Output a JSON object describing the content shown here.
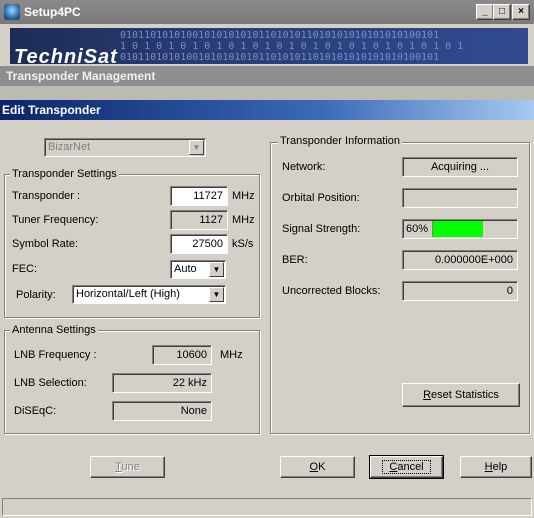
{
  "window": {
    "title": "Setup4PC"
  },
  "banner": {
    "logo": "TechniSat",
    "binary_rows": [
      "01011010101001010101010110101011010101010101010100101",
      "1 0 1 0 1 0 1 0 1 0 1 0 1 0 1 0 1 0 1 0 1 0 1 0 1 0 1 0 1"
    ]
  },
  "section": {
    "title": "Transponder Management"
  },
  "dialog": {
    "title": "Edit Transponder",
    "network_combo": "BizarNet",
    "transponder_settings": {
      "title": "Transponder Settings",
      "transponder_label": "Transponder :",
      "transponder_value": "11727",
      "transponder_unit": "MHz",
      "tuner_label": "Tuner Frequency:",
      "tuner_value": "1127",
      "tuner_unit": "MHz",
      "symbol_label": "Symbol Rate:",
      "symbol_value": "27500",
      "symbol_unit": "kS/s",
      "fec_label": "FEC:",
      "fec_value": "Auto",
      "polarity_label": "Polarity:",
      "polarity_value": "Horizontal/Left (High)"
    },
    "antenna_settings": {
      "title": "Antenna Settings",
      "lnb_freq_label": "LNB Frequency :",
      "lnb_freq_value": "10600",
      "lnb_freq_unit": "MHz",
      "lnb_sel_label": "LNB Selection:",
      "lnb_sel_value": "22 kHz",
      "diseqc_label": "DiSEqC:",
      "diseqc_value": "None"
    },
    "info": {
      "title": "Transponder Information",
      "network_label": "Network:",
      "network_value": "Acquiring ...",
      "orbital_label": "Orbital Position:",
      "orbital_value": "",
      "signal_label": "Signal Strength:",
      "signal_text": "60%",
      "signal_fraction": 0.6,
      "signal_color": "#00ff00",
      "ber_label": "BER:",
      "ber_value": "0.000000E+000",
      "uncorrected_label": "Uncorrected Blocks:",
      "uncorrected_value": "0",
      "reset_first": "R",
      "reset_rest": "eset Statistics"
    },
    "buttons": {
      "tune_first": "T",
      "tune_rest": "une",
      "ok_first": "O",
      "ok_rest": "K",
      "cancel_first": "C",
      "cancel_rest": "ancel",
      "help_first": "H",
      "help_rest": "elp"
    }
  }
}
